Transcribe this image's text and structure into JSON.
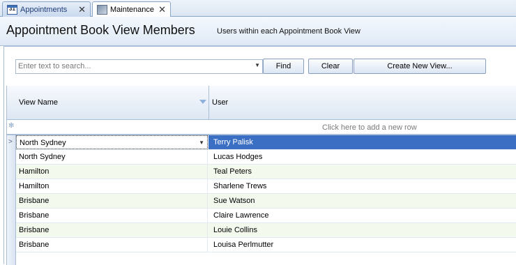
{
  "tabs": [
    {
      "label": "Appointments",
      "icon": "calendar-icon",
      "icon_text": "31",
      "active": false
    },
    {
      "label": "Maintenance",
      "icon": "wrench-icon",
      "active": true
    }
  ],
  "tab_close_glyph": "✕",
  "header": {
    "title": "Appointment Book View Members",
    "subtitle": "Users within each Appointment Book View"
  },
  "toolbar": {
    "search_placeholder": "Enter text to search...",
    "find_label": "Find",
    "clear_label": "Clear",
    "create_label": "Create New View..."
  },
  "grid": {
    "columns": [
      "View Name",
      "User"
    ],
    "new_row_hint": "Click here to add a new row",
    "rows": [
      {
        "view": "North Sydney",
        "user": "Terry Palisk"
      },
      {
        "view": "North Sydney",
        "user": "Lucas Hodges"
      },
      {
        "view": "Hamilton",
        "user": "Teal Peters"
      },
      {
        "view": "Hamilton",
        "user": "Sharlene Trews"
      },
      {
        "view": "Brisbane",
        "user": "Sue Watson"
      },
      {
        "view": "Brisbane",
        "user": "Claire Lawrence"
      },
      {
        "view": "Brisbane",
        "user": "Louie Collins"
      },
      {
        "view": "Brisbane",
        "user": "Louisa Perlmutter"
      }
    ]
  },
  "colors": {
    "selection": "#3b6fc4",
    "accent": "#a9bfd9"
  }
}
